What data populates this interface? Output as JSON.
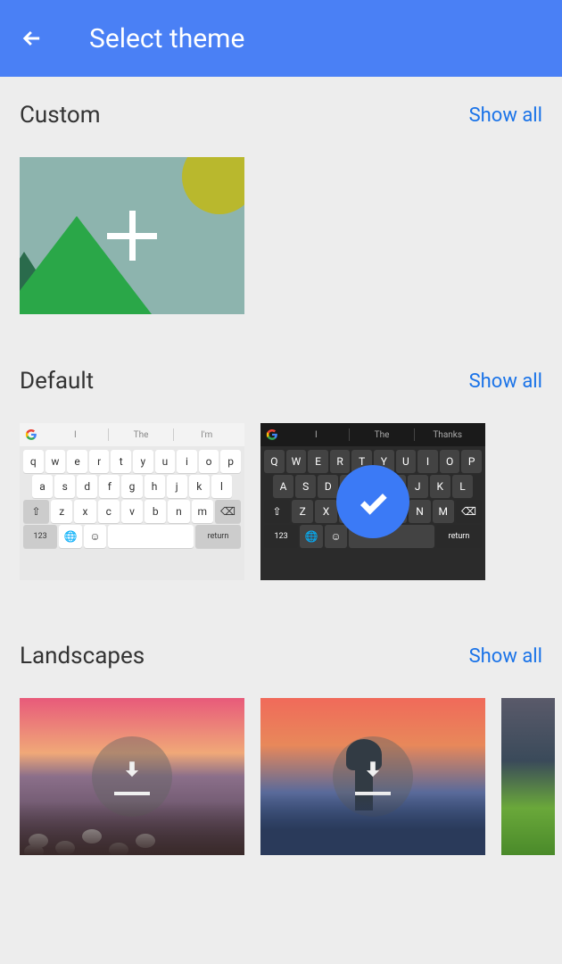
{
  "header": {
    "title": "Select theme"
  },
  "sections": {
    "custom": {
      "title": "Custom",
      "show_all": "Show all"
    },
    "default": {
      "title": "Default",
      "show_all": "Show all",
      "keyboard_light_suggestions": [
        "I",
        "The",
        "I'm"
      ],
      "keyboard_dark_suggestions": [
        "I",
        "The",
        "Thanks"
      ],
      "row1": [
        "q",
        "w",
        "e",
        "r",
        "t",
        "y",
        "u",
        "i",
        "o",
        "p"
      ],
      "row1_caps": [
        "Q",
        "W",
        "E",
        "R",
        "T",
        "Y",
        "U",
        "I",
        "O",
        "P"
      ],
      "row2": [
        "a",
        "s",
        "d",
        "f",
        "g",
        "h",
        "j",
        "k",
        "l"
      ],
      "row2_caps": [
        "A",
        "S",
        "D",
        "F",
        "G",
        "H",
        "J",
        "K",
        "L"
      ],
      "row3": [
        "z",
        "x",
        "c",
        "v",
        "b",
        "n",
        "m"
      ],
      "row3_caps": [
        "Z",
        "X",
        "C",
        "V",
        "B",
        "N",
        "M"
      ],
      "key_123": "123",
      "key_return": "return"
    },
    "landscapes": {
      "title": "Landscapes",
      "show_all": "Show all"
    }
  }
}
